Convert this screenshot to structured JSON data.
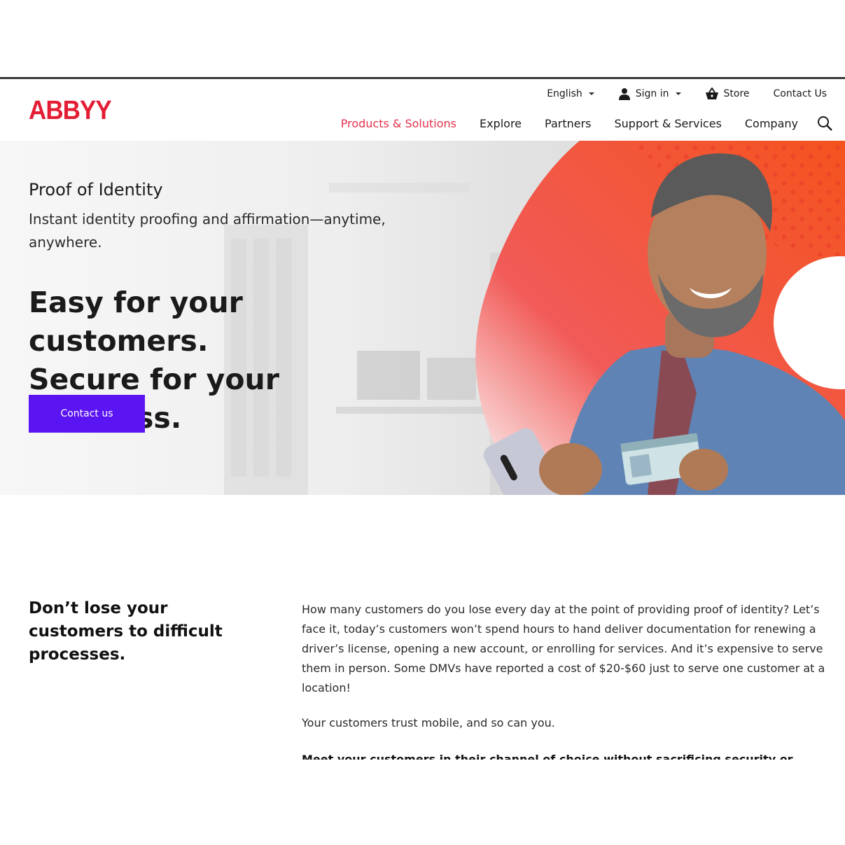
{
  "brand": {
    "logo_text": "ABBYY",
    "accent_color": "#e31e34",
    "cta_color": "#5a15f2",
    "active_nav_color": "#e3324a"
  },
  "utility_nav": {
    "language": "English",
    "sign_in": "Sign in",
    "store": "Store",
    "contact": "Contact Us"
  },
  "main_nav": {
    "items": [
      "Products & Solutions",
      "Explore",
      "Partners",
      "Support & Services",
      "Company"
    ],
    "active_index": 0,
    "search_icon": "search-icon"
  },
  "hero": {
    "eyebrow": "Proof of Identity",
    "subtitle": "Instant identity proofing and affirmation—anytime, anywhere.",
    "title_line1": "Easy for your customers.",
    "title_line2": "Secure for your business.",
    "cta_label": "Contact us"
  },
  "section": {
    "title": "Don’t lose your customers to difficult processes.",
    "paragraph1": "How many customers do you lose every day at the point of providing proof of identity? Let’s face it, today’s customers won’t spend hours to hand deliver documentation for renewing a driver’s license, opening a new account, or enrolling for services. And it’s expensive to serve them in person. Some DMVs have reported a cost of $20-$60 just to serve one customer at a location!",
    "paragraph2": "Your customers trust mobile, and so can you.",
    "paragraph3_bold": "Meet your customers in their channel of choice without sacrificing security or efficiency."
  }
}
